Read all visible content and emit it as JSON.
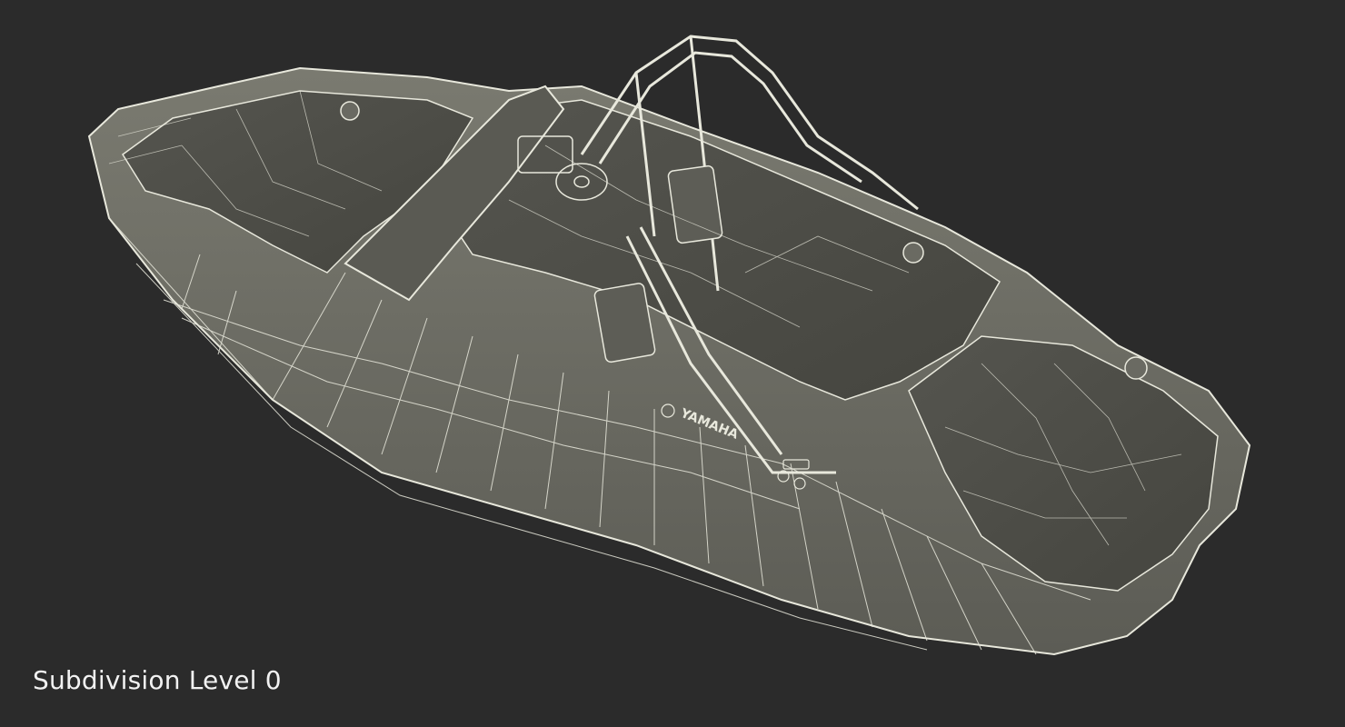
{
  "viewport": {
    "background": "#2b2b2b",
    "caption": "Subdivision Level 0",
    "caption_color": "#f2f2f2"
  },
  "model": {
    "brand_text": "YAMAHA",
    "surface_color": "#6f6f66",
    "wire_color": "#e8e8dc",
    "shadow_color": "#4d4d47"
  }
}
